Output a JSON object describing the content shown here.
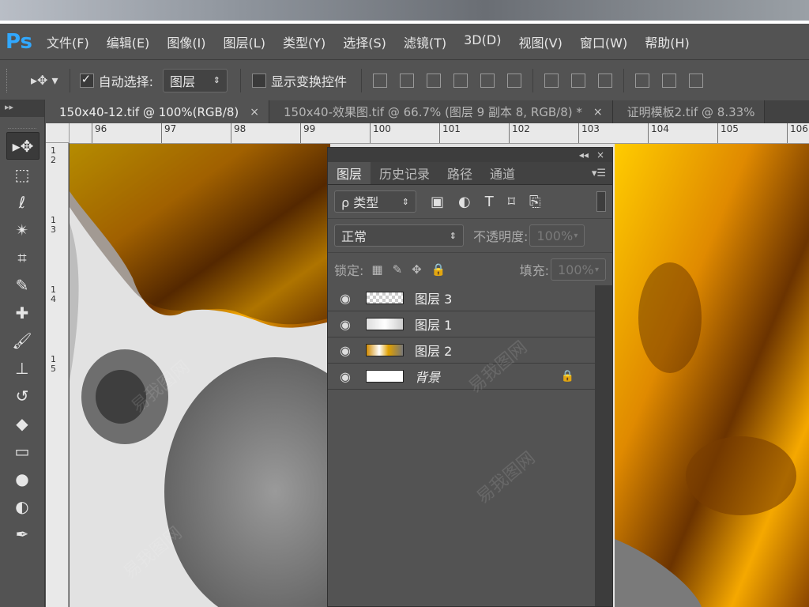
{
  "app": {
    "logo": "Ps"
  },
  "menu": [
    "文件(F)",
    "编辑(E)",
    "图像(I)",
    "图层(L)",
    "类型(Y)",
    "选择(S)",
    "滤镜(T)",
    "3D(D)",
    "视图(V)",
    "窗口(W)",
    "帮助(H)"
  ],
  "options": {
    "auto_select_label": "自动选择:",
    "auto_select_value": "图层",
    "show_transform_label": "显示变换控件"
  },
  "tabs": [
    {
      "label": "150x40-12.tif @ 100%(RGB/8)",
      "close": "×"
    },
    {
      "label": "150x40-效果图.tif @ 66.7% (图层 9 副本 8, RGB/8) *",
      "close": "×"
    },
    {
      "label": "证明模板2.tif @ 8.33%",
      "close": ""
    }
  ],
  "ruler": {
    "h": [
      "96",
      "97",
      "98",
      "99",
      "100",
      "101",
      "102",
      "103",
      "104",
      "105",
      "106"
    ],
    "v": [
      "1 2",
      "1 3",
      "1 4",
      "1 5"
    ]
  },
  "layers_panel": {
    "tabs": [
      "图层",
      "历史记录",
      "路径",
      "通道"
    ],
    "filter_label": "ρ 类型",
    "blend_mode": "正常",
    "opacity_label": "不透明度:",
    "opacity_value": "100%",
    "lock_label": "锁定:",
    "fill_label": "填充:",
    "fill_value": "100%",
    "layers": [
      {
        "name": "图层 3",
        "thumb": "checker"
      },
      {
        "name": "图层 1",
        "thumb": "light"
      },
      {
        "name": "图层 2",
        "thumb": "mixed"
      },
      {
        "name": "背景",
        "thumb": "white",
        "locked": true
      }
    ]
  },
  "toolbox": {
    "header": "▸▸"
  },
  "watermark": "易我图网"
}
